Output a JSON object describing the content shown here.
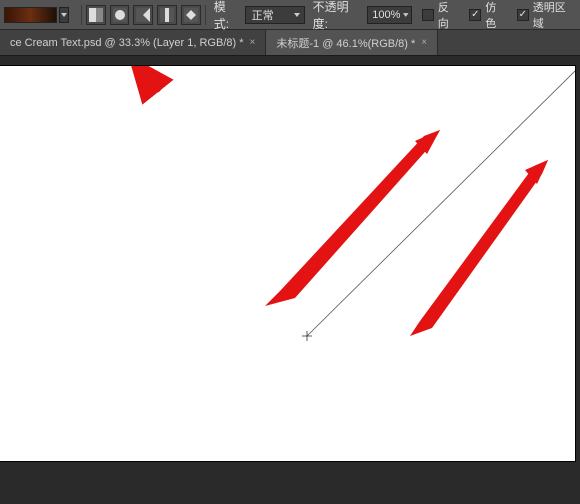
{
  "options_bar": {
    "mode_label": "模式:",
    "mode_value": "正常",
    "opacity_label": "不透明度:",
    "opacity_value": "100%",
    "checkboxes": {
      "reverse": {
        "label": "反向",
        "checked": false
      },
      "dither": {
        "label": "仿色",
        "checked": true
      },
      "transparency": {
        "label": "透明区域",
        "checked": true
      }
    }
  },
  "tabs": [
    {
      "label": "ce Cream Text.psd @ 33.3% (Layer 1, RGB/8) *",
      "active": false
    },
    {
      "label": "未标题-1 @ 46.1%(RGB/8) *",
      "active": true
    }
  ],
  "icons": {
    "linear": "linear-gradient-icon",
    "radial": "radial-gradient-icon",
    "angle": "angle-gradient-icon",
    "reflected": "reflected-gradient-icon",
    "diamond": "diamond-gradient-icon"
  }
}
